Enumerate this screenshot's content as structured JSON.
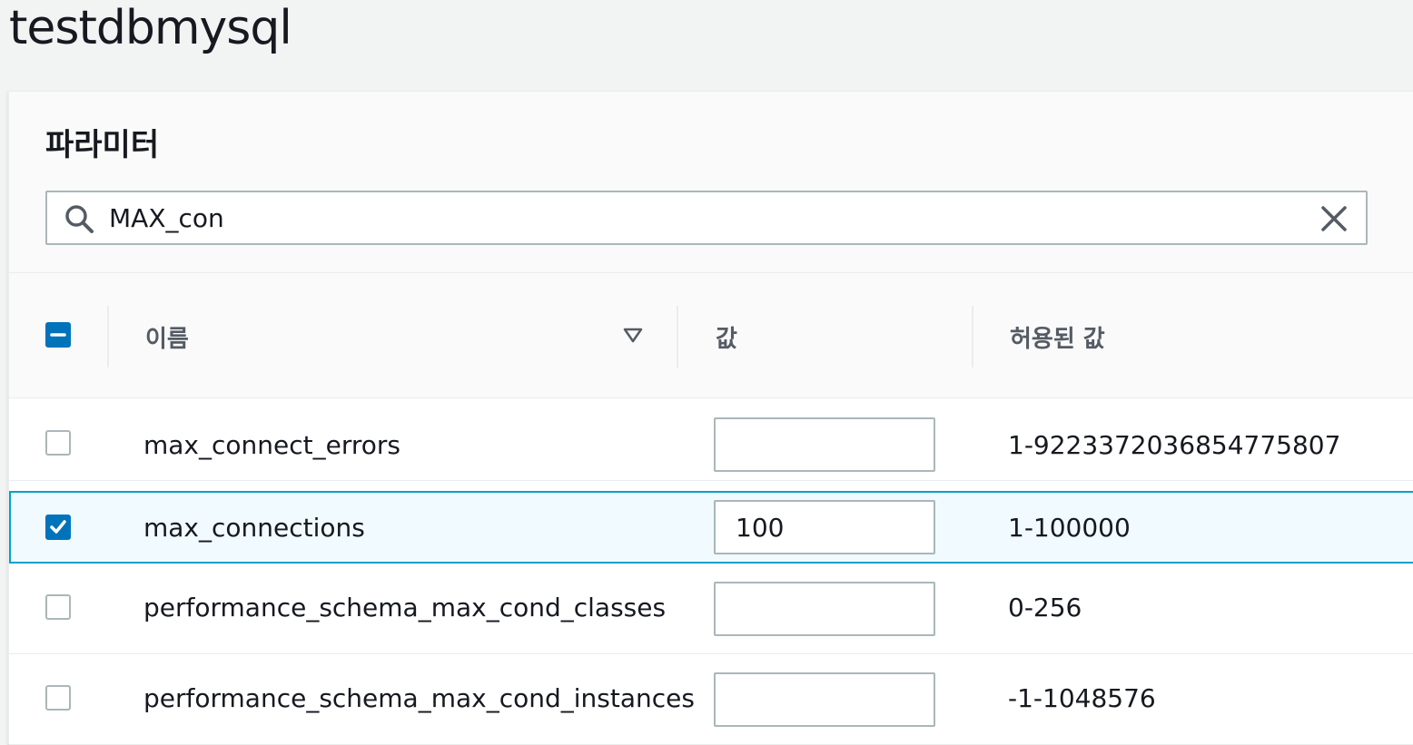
{
  "page": {
    "title": "testdbmysql"
  },
  "panel": {
    "title": "파라미터",
    "search": {
      "value": "MAX_con",
      "placeholder": ""
    }
  },
  "table": {
    "columns": {
      "name": "이름",
      "value": "값",
      "allowed": "허용된 값"
    },
    "select_all_state": "indeterminate",
    "sort_icon": "triangle-down-icon",
    "rows": [
      {
        "name": "max_connect_errors",
        "value": "",
        "allowed": "1-9223372036854775807",
        "selected": false
      },
      {
        "name": "max_connections",
        "value": "100",
        "allowed": "1-100000",
        "selected": true
      },
      {
        "name": "performance_schema_max_cond_classes",
        "value": "",
        "allowed": "0-256",
        "selected": false
      },
      {
        "name": "performance_schema_max_cond_instances",
        "value": "",
        "allowed": "-1-1048576",
        "selected": false
      }
    ]
  },
  "colors": {
    "accent": "#0073bb",
    "selected_row_bg": "#f1faff",
    "selected_row_border": "#00a1c9"
  }
}
